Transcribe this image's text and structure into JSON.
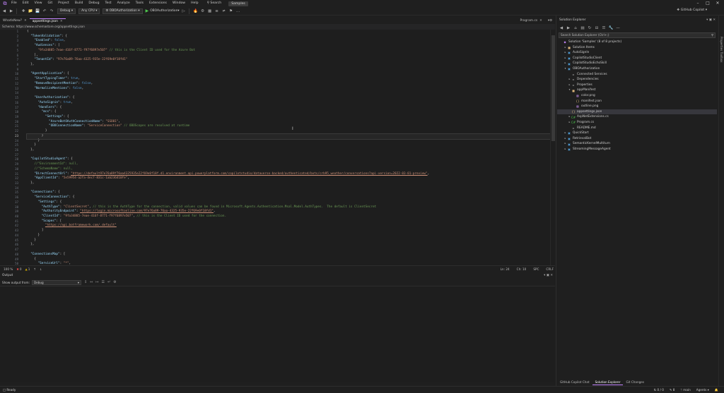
{
  "menu": {
    "items": [
      "File",
      "Edit",
      "View",
      "Git",
      "Project",
      "Build",
      "Debug",
      "Test",
      "Analyze",
      "Tools",
      "Extensions",
      "Window",
      "Help"
    ],
    "search_label": "Search",
    "solution_name": "Samples"
  },
  "toolbar": {
    "config": "Debug",
    "platform": "Any CPU",
    "startup_project": "OBOAuthorization",
    "run_target": "OBOAuthorization",
    "copilot_label": "GitHub Copilot"
  },
  "editor_tabs": {
    "left_tab": "WhatIsNew?",
    "active_tab": "appsettings.json",
    "right_tab": "Program.cs"
  },
  "schema": {
    "label": "Schema:",
    "url": "https://www.schemastore.org/appsettings.json"
  },
  "code_lines": [
    {
      "n": "1",
      "html": "<span class='tok-punc'>{</span>"
    },
    {
      "n": "2",
      "html": "  <span class='tok-key'>\"TokenValidation\"</span><span class='tok-punc'>: {</span>"
    },
    {
      "n": "3",
      "html": "    <span class='tok-key'>\"Enabled\"</span><span class='tok-punc'>: </span><span class='tok-kw'>false</span><span class='tok-punc'>,</span>"
    },
    {
      "n": "4",
      "html": "    <span class='tok-key'>\"Audiences\"</span><span class='tok-punc'>: [</span>"
    },
    {
      "n": "5",
      "html": "      <span class='tok-str'>\"9fa34885-7eae-416f-8771-f97f6897e507\"</span> <span class='tok-cmt'>// this is the Client ID used for the Azure Bot</span>"
    },
    {
      "n": "6",
      "html": "    <span class='tok-punc'>],</span>"
    },
    {
      "n": "7",
      "html": "    <span class='tok-key'>\"TenantId\"</span><span class='tok-punc'>: </span><span class='tok-str'>\"97e76a89-76aa-4325-935e-22f69e0f18fd1\"</span>"
    },
    {
      "n": "8",
      "html": "  <span class='tok-punc'>},</span>"
    },
    {
      "n": "9",
      "html": ""
    },
    {
      "n": "10",
      "html": "  <span class='tok-key'>\"AgentApplication\"</span><span class='tok-punc'>: {</span>"
    },
    {
      "n": "11",
      "html": "    <span class='tok-key'>\"StartTypingTimer\"</span><span class='tok-punc'>: </span><span class='tok-kw'>true</span><span class='tok-punc'>,</span>"
    },
    {
      "n": "12",
      "html": "    <span class='tok-key'>\"RemoveRecipientMention\"</span><span class='tok-punc'>: </span><span class='tok-kw'>false</span><span class='tok-punc'>,</span>"
    },
    {
      "n": "13",
      "html": "    <span class='tok-key'>\"NormalizeMentions\"</span><span class='tok-punc'>: </span><span class='tok-kw'>false</span><span class='tok-punc'>,</span>"
    },
    {
      "n": "14",
      "html": ""
    },
    {
      "n": "15",
      "html": "    <span class='tok-key'>\"UserAuthorization\"</span><span class='tok-punc'>: {</span>"
    },
    {
      "n": "16",
      "html": "      <span class='tok-key'>\"AutoSignin\"</span><span class='tok-punc'>: </span><span class='tok-kw'>true</span><span class='tok-punc'>,</span>"
    },
    {
      "n": "17",
      "html": "      <span class='tok-key'>\"Handlers\"</span><span class='tok-punc'>: {</span>"
    },
    {
      "n": "18",
      "html": "        <span class='tok-key'>\"mcs\"</span><span class='tok-punc'>: {</span>"
    },
    {
      "n": "19",
      "html": "          <span class='tok-key'>\"Settings\"</span><span class='tok-punc'>: {</span>"
    },
    {
      "n": "20",
      "html": "            <span class='tok-key'>\"AzureBotOAuthConnectionName\"</span><span class='tok-punc'>: </span><span class='tok-str'>\"SSO01\"</span><span class='tok-punc'>,</span>"
    },
    {
      "n": "21",
      "html": "            <span class='tok-key'>\"OBOConnectionName\"</span><span class='tok-punc'>: </span><span class='tok-str'>\"ServiceConnection\"</span> <span class='tok-cmt'>// OBOScopes are resolved at runtime</span>"
    },
    {
      "n": "22",
      "html": "          <span class='tok-punc'>}</span>"
    },
    {
      "n": "23",
      "html": "        <span class='tok-punc'>}</span>",
      "current": true
    },
    {
      "n": "24",
      "html": "      <span class='tok-punc'>}</span>"
    },
    {
      "n": "25",
      "html": "    <span class='tok-punc'>}</span>"
    },
    {
      "n": "26",
      "html": "  <span class='tok-punc'>},</span>"
    },
    {
      "n": "27",
      "html": ""
    },
    {
      "n": "28",
      "html": "  <span class='tok-key'>\"CopilotStudioAgent\"</span><span class='tok-punc'>: {</span>"
    },
    {
      "n": "29",
      "html": "    <span class='tok-cmt'>//\"EnvironmentId\": null,</span>"
    },
    {
      "n": "30",
      "html": "    <span class='tok-cmt'>//\"SchemaName\": null,</span>"
    },
    {
      "n": "31",
      "html": "    <span class='tok-key'>\"DirectConnectUrl\"</span><span class='tok-punc'>: </span><span class='tok-link'>\"https://default97e76a89f76aa4325935e22f69e0f18f.d1.environment.api.powerplatform.com/copilotstudio/dataverse-backed/authenticated/bots/crb95_weather/conversations?api-version=2022-03-01-preview\"</span><span class='tok-punc'>,</span>"
    },
    {
      "n": "32",
      "html": "    <span class='tok-key'>\"AppClientId\"</span><span class='tok-punc'>: </span><span class='tok-str'>\"5e59954-a2fa-4ec7-831c-1ab236410fe\"</span><span class='tok-punc'>,</span>"
    },
    {
      "n": "33",
      "html": "  <span class='tok-punc'>},</span>"
    },
    {
      "n": "34",
      "html": ""
    },
    {
      "n": "35",
      "html": "  <span class='tok-key'>\"Connections\"</span><span class='tok-punc'>: {</span>"
    },
    {
      "n": "36",
      "html": "    <span class='tok-key'>\"ServiceConnection\"</span><span class='tok-punc'>: {</span>"
    },
    {
      "n": "37",
      "html": "      <span class='tok-key'>\"Settings\"</span><span class='tok-punc'>: {</span>"
    },
    {
      "n": "38",
      "html": "        <span class='tok-key'>\"AuthType\"</span><span class='tok-punc'>: </span><span class='tok-str'>\"ClientSecret\"</span><span class='tok-punc'>,</span> <span class='tok-cmt'>// this is the AuthType for the connection, valid values can be found in Microsoft.Agents.Authentication.Msal.Model.AuthTypes.  The default is ClientSecret</span>"
    },
    {
      "n": "39",
      "html": "        <span class='tok-key'>\"AuthorityEndpoint\"</span><span class='tok-punc'>: </span><span class='tok-link'>\"https://login.microsoftonline.com/97e76a89-76aa-4325-935e-22f69e0f18fd1\"</span><span class='tok-punc'>,</span>"
    },
    {
      "n": "40",
      "html": "        <span class='tok-key'>\"ClientId\"</span><span class='tok-punc'>: </span><span class='tok-str'>\"9fa34885-7eae-416f-8771-f97f6897e507\"</span><span class='tok-punc'>,</span> <span class='tok-cmt'>// this is the Client ID used for the connection.</span>"
    },
    {
      "n": "41",
      "html": "        <span class='tok-key'>\"Scopes\"</span><span class='tok-punc'>: [</span>"
    },
    {
      "n": "42",
      "html": "          <span class='tok-link'>\"https://api.botframework.com/.default\"</span>"
    },
    {
      "n": "43",
      "html": "        <span class='tok-punc'>]</span>"
    },
    {
      "n": "44",
      "html": "      <span class='tok-punc'>}</span>"
    },
    {
      "n": "45",
      "html": "    <span class='tok-punc'>}</span>"
    },
    {
      "n": "46",
      "html": "  <span class='tok-punc'>},</span>"
    },
    {
      "n": "47",
      "html": ""
    },
    {
      "n": "48",
      "html": "  <span class='tok-key'>\"ConnectionsMap\"</span><span class='tok-punc'>: [</span>"
    },
    {
      "n": "49",
      "html": "    <span class='tok-punc'>{</span>"
    },
    {
      "n": "50",
      "html": "      <span class='tok-key'>\"ServiceUrl\"</span><span class='tok-punc'>: </span><span class='tok-str'>\"*\"</span><span class='tok-punc'>,</span>"
    }
  ],
  "editor_status": {
    "zoom": "100 %",
    "errors": "0",
    "warnings": "1",
    "line": "Ln: 24",
    "col": "Ch: 10",
    "spc": "SPC",
    "eol": "CRLF"
  },
  "output": {
    "title": "Output",
    "show_from_label": "Show output from:",
    "source": "Debug"
  },
  "solution_explorer": {
    "title": "Solution Explorer",
    "search_placeholder": "Search Solution Explorer (Ctrl+;)",
    "tree": [
      {
        "indent": 0,
        "arrow": "",
        "icon": "sln",
        "label": "Solution 'Samples' (8 of 8 projects)"
      },
      {
        "indent": 1,
        "arrow": "▸",
        "icon": "folder",
        "label": "Solution Items"
      },
      {
        "indent": 1,
        "arrow": "▸",
        "icon": "proj",
        "label": "AutoSignIn"
      },
      {
        "indent": 1,
        "arrow": "▸",
        "icon": "proj",
        "label": "CopilotStudioClient"
      },
      {
        "indent": 1,
        "arrow": "▸",
        "icon": "proj",
        "label": "CopilotStudioEchoSkill"
      },
      {
        "indent": 1,
        "arrow": "▾",
        "icon": "proj",
        "label": "OBOAuthorization"
      },
      {
        "indent": 2,
        "arrow": "",
        "icon": "file",
        "label": "Connected Services"
      },
      {
        "indent": 2,
        "arrow": "▸",
        "icon": "file",
        "label": "Dependencies"
      },
      {
        "indent": 2,
        "arrow": "▸",
        "icon": "file",
        "label": "Properties"
      },
      {
        "indent": 2,
        "arrow": "▾",
        "icon": "folder",
        "label": "appManifest"
      },
      {
        "indent": 3,
        "arrow": "",
        "icon": "img",
        "label": "color.png"
      },
      {
        "indent": 3,
        "arrow": "",
        "icon": "json",
        "label": "manifest.json"
      },
      {
        "indent": 3,
        "arrow": "",
        "icon": "img",
        "label": "outline.png"
      },
      {
        "indent": 2,
        "arrow": "",
        "icon": "json",
        "label": "appsettings.json",
        "selected": true
      },
      {
        "indent": 2,
        "arrow": "▸",
        "icon": "cs",
        "label": "AspNetExtensions.cs"
      },
      {
        "indent": 2,
        "arrow": "▸",
        "icon": "cs",
        "label": "Program.cs"
      },
      {
        "indent": 2,
        "arrow": "",
        "icon": "file",
        "label": "README.md"
      },
      {
        "indent": 1,
        "arrow": "▸",
        "icon": "proj",
        "label": "QuickStart"
      },
      {
        "indent": 1,
        "arrow": "▸",
        "icon": "proj",
        "label": "RetrievalBot"
      },
      {
        "indent": 1,
        "arrow": "▸",
        "icon": "proj",
        "label": "SemanticKernelMultiturn"
      },
      {
        "indent": 1,
        "arrow": "▸",
        "icon": "proj",
        "label": "StreamingMessageAgent"
      }
    ],
    "bottom_tabs": [
      "GitHub Copilot Chat",
      "Solution Explorer",
      "Git Changes"
    ]
  },
  "right_edge_label": "Properties    Toolbox",
  "statusbar": {
    "ready": "Ready",
    "up_down": "0 / 0",
    "pencil": "8",
    "branch": "main",
    "agents": "Agents"
  }
}
